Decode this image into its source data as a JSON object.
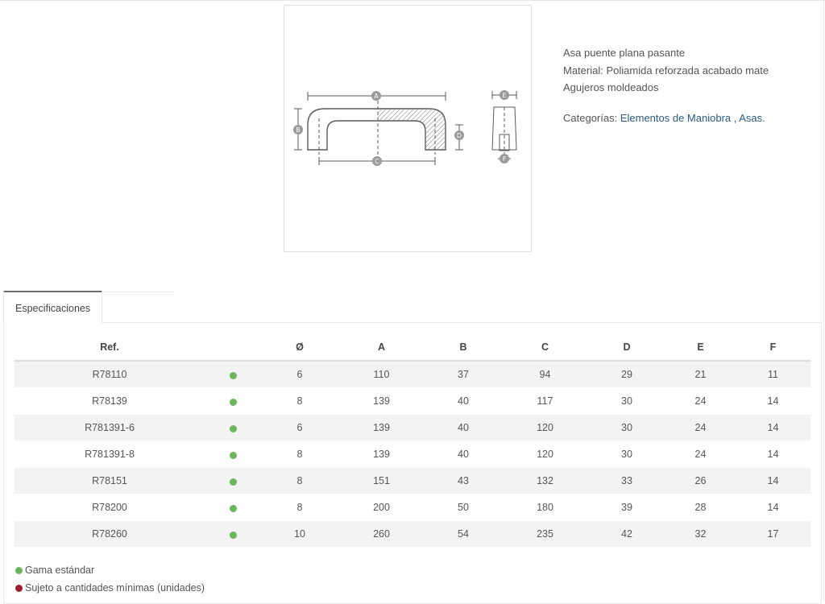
{
  "product": {
    "description_lines": [
      "Asa puente plana pasante",
      "Material: Poliamida reforzada acabado mate",
      "Agujeros moldeados"
    ],
    "categories_label": "Categorías:",
    "categories": [
      "Elementos de Maniobra",
      "Asas."
    ],
    "categories_separator": " , "
  },
  "drawing": {
    "dimension_letters": [
      "A",
      "B",
      "C",
      "D",
      "E",
      "F"
    ]
  },
  "tabs": [
    {
      "label": "Especificaciones",
      "active": true
    }
  ],
  "specs_table": {
    "headers": [
      "Ref.",
      "",
      "Ø",
      "A",
      "B",
      "C",
      "D",
      "E",
      "F"
    ],
    "rows": [
      {
        "ref": "R78110",
        "status": "green",
        "d": "6",
        "a": "110",
        "b": "37",
        "c": "94",
        "dd": "29",
        "e": "21",
        "f": "11"
      },
      {
        "ref": "R78139",
        "status": "green",
        "d": "8",
        "a": "139",
        "b": "40",
        "c": "117",
        "dd": "30",
        "e": "24",
        "f": "14"
      },
      {
        "ref": "R781391-6",
        "status": "green",
        "d": "6",
        "a": "139",
        "b": "40",
        "c": "120",
        "dd": "30",
        "e": "24",
        "f": "14"
      },
      {
        "ref": "R781391-8",
        "status": "green",
        "d": "8",
        "a": "139",
        "b": "40",
        "c": "120",
        "dd": "30",
        "e": "24",
        "f": "14"
      },
      {
        "ref": "R78151",
        "status": "green",
        "d": "8",
        "a": "151",
        "b": "43",
        "c": "132",
        "dd": "33",
        "e": "26",
        "f": "14"
      },
      {
        "ref": "R78200",
        "status": "green",
        "d": "8",
        "a": "200",
        "b": "50",
        "c": "180",
        "dd": "39",
        "e": "28",
        "f": "14"
      },
      {
        "ref": "R78260",
        "status": "green",
        "d": "10",
        "a": "260",
        "b": "54",
        "c": "235",
        "dd": "42",
        "e": "32",
        "f": "17"
      }
    ]
  },
  "legend": [
    {
      "color": "#6cb55c",
      "label": "Gama estándar"
    },
    {
      "color": "#9e1f2b",
      "label": "Sujeto a cantidades mínimas (unidades)"
    }
  ],
  "colors": {
    "status_green": "#6cb55c",
    "status_red": "#9e1f2b",
    "link": "#2a5a86"
  }
}
